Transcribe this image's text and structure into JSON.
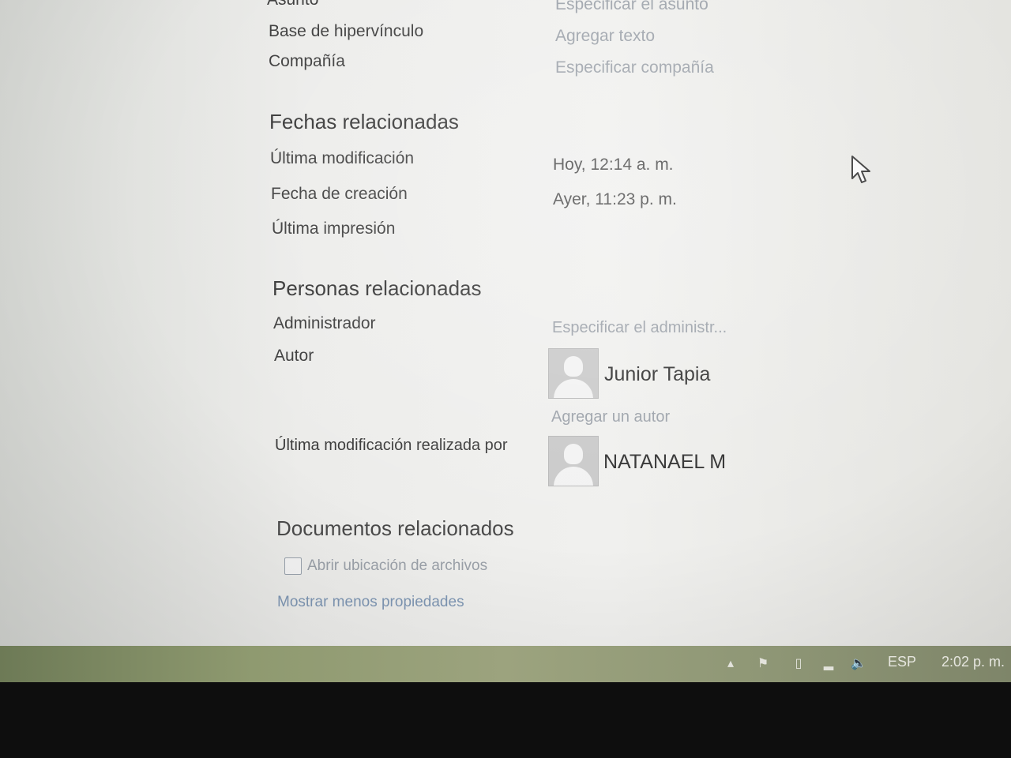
{
  "properties": {
    "rows_top": [
      {
        "label": "Asunto",
        "value": "Especificar el asunto"
      },
      {
        "label": "Base de hipervínculo",
        "value": "Agregar texto"
      },
      {
        "label": "Compañía",
        "value": "Especificar compañía"
      }
    ]
  },
  "dates": {
    "heading": "Fechas relacionadas",
    "last_modified": {
      "label": "Última modificación",
      "value": "Hoy, 12:14 a. m."
    },
    "created": {
      "label": "Fecha de creación",
      "value": "Ayer, 11:23 p. m."
    },
    "last_printed": {
      "label": "Última impresión"
    }
  },
  "people": {
    "heading": "Personas relacionadas",
    "manager": {
      "label": "Administrador",
      "placeholder": "Especificar el administr..."
    },
    "author": {
      "label": "Autor",
      "name": "Junior Tapia",
      "add_label": "Agregar un autor"
    },
    "last_modified_by": {
      "label": "Última modificación realizada por",
      "name": "NATANAEL M"
    }
  },
  "documents": {
    "heading": "Documentos relacionados",
    "open_location": "Abrir ubicación de archivos",
    "show_less": "Mostrar menos propiedades"
  },
  "taskbar": {
    "language": "ESP",
    "time": "2:02 p. m."
  }
}
